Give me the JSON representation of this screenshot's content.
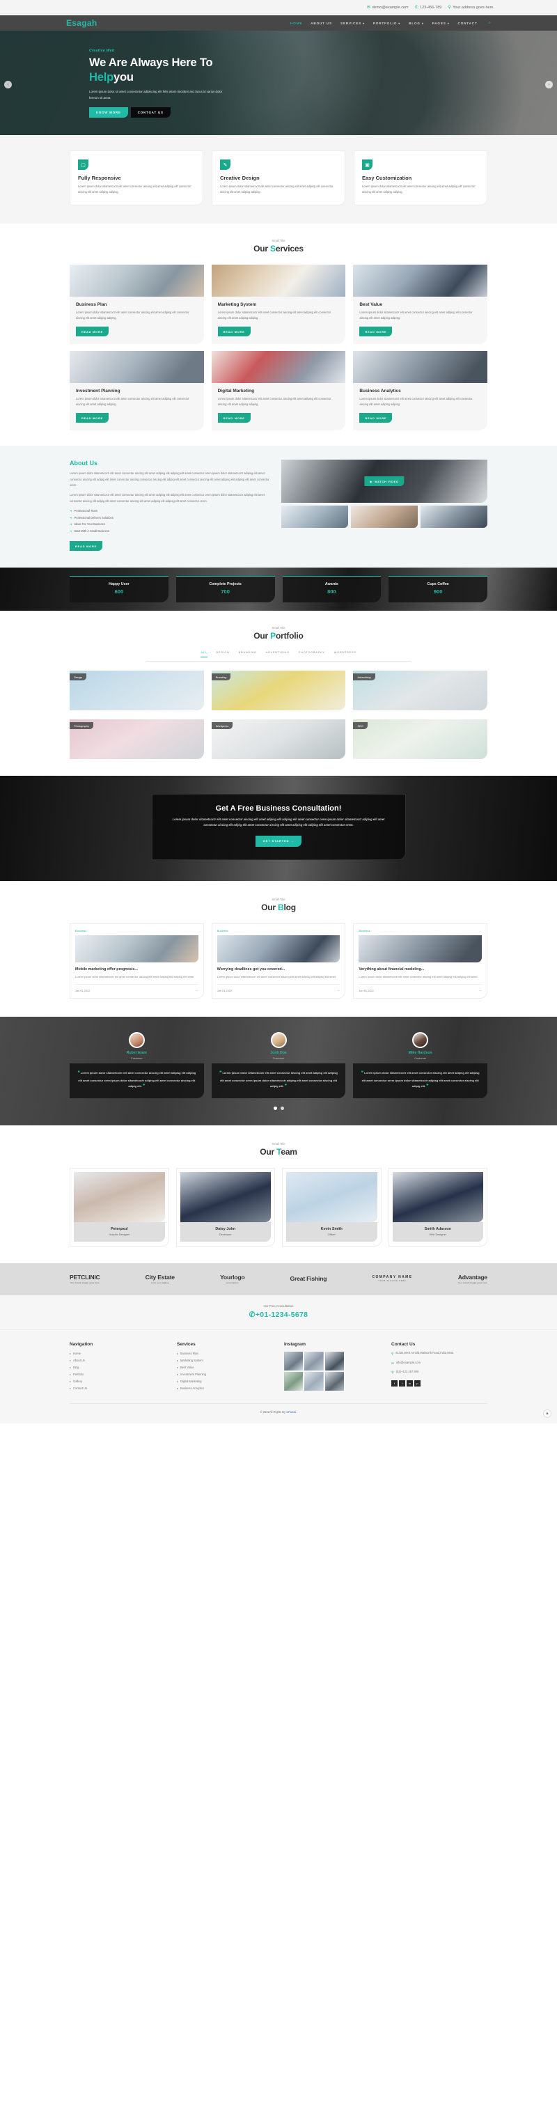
{
  "topbar": {
    "email": "demo@example.com",
    "phone": "123-456-789",
    "address": "Your address goes here."
  },
  "nav": {
    "brand": "Esagah",
    "items": [
      {
        "label": "HOME",
        "caret": ""
      },
      {
        "label": "ABOUT US",
        "caret": ""
      },
      {
        "label": "SERVICES",
        "caret": "▾"
      },
      {
        "label": "PORTFOLIO",
        "caret": "▾"
      },
      {
        "label": "BLOG",
        "caret": "▾"
      },
      {
        "label": "PAGES",
        "caret": "▾"
      },
      {
        "label": "CONTACT",
        "caret": ""
      }
    ]
  },
  "hero": {
    "small": "Creative Web",
    "title_line1": "We Are Always Here To",
    "title_accent": "Help",
    "title_rest": "you",
    "text": "Lorem ipsum dolor sit amet consectetur adipiscing elit felis etiam tincidunt arci lacus id varius dolor fermun sit amet.",
    "btn_primary": "KNOW MORE",
    "btn_secondary": "CONTGAT US",
    "arrow_left": "‹",
    "arrow_right": "›"
  },
  "features": [
    {
      "icon": "monitor-icon",
      "glyph": "▢",
      "title": "Fully Responsive",
      "text": "Lorem ipsum dolor sitametcoctr elit amet consectur aiscing elit amet adipisg elit consectur aiscing elit amet adipisg adipisg."
    },
    {
      "icon": "pencil-icon",
      "glyph": "✎",
      "title": "Creative Design",
      "text": "Lorem ipsum dolor sitametcoctr elit amet consectur aiscing elit amet adipisg elit consectur aiscing elit amet adipisg adipisg."
    },
    {
      "icon": "layout-icon",
      "glyph": "▣",
      "title": "Easy Customization",
      "text": "Lorem ipsum dolor sitametcoctr elit amet consectur aiscing elit amet adipisg elit consectur aiscing elit amet adipisg adipisg."
    }
  ],
  "services": {
    "small_title": "Small Title",
    "title_first": "Our ",
    "title_accent": "S",
    "title_rest": "ervices",
    "read_more": "READ MORE",
    "items": [
      {
        "title": "Business Plan",
        "text": "Lorem ipsum dolor sitametcoctr elit amet consectur aiscing elit amet adipisg elit consectur aiscing elit amet adipisg adipisg."
      },
      {
        "title": "Marketing System",
        "text": "Lorem ipsum dolor sitametcoctr elit amet consectur aiscing elit amet adipisg elit consectur aiscing elit amet adipisg adipisg."
      },
      {
        "title": "Best Value",
        "text": "Lorem ipsum dolor sitametcoctr elit amet consectur aiscing elit amet adipisg elit consectur aiscing elit amet adipisg adipisg."
      },
      {
        "title": "Investment Planning",
        "text": "Lorem ipsum dolor sitametcoctr elit amet consectur aiscing elit amet adipisg elit consectur aiscing elit amet adipisg adipisg."
      },
      {
        "title": "Digital Marketing",
        "text": "Lorem ipsum dolor sitametcoctr elit amet consectur aiscing elit amet adipisg elit consectur aiscing elit amet adipisg adipisg."
      },
      {
        "title": "Business Analytics",
        "text": "Lorem ipsum dolor sitametcoctr elit amet consectur aiscing elit amet adipisg elit consectur aiscing elit amet adipisg adipisg."
      }
    ]
  },
  "about": {
    "title": "About Us",
    "p1": "Lorem ipsum dolor sitametcoctr elit amet consectur aiscing elit amet adipisg elit adipisg elit amet consectur orem ipsum dolor sitametcoctr adipisg elit amet consectur aiscing elit adipig elit amet consectur aiscing consectur aiscing elit adipig elit amet consectur aiscing elit amet adipisg elit adipisg elit amet consectur orem.",
    "p2": "Lorem ipsum dolor sitametcoctr elit amet consectur aiscing elit amet adipisg elit adipisg elit amet consectur orem ipsum dolor sitametcoctr adipisg elit amet consectur aiscing elit adipig elit amet consectur aiscing elit amet adipisg elit adipisg elit amet consectur orem.",
    "bullets": [
      "Professional Team",
      "Professional Delivers Solutions",
      "Ideas For Your Business",
      "Start With A Small Business"
    ],
    "read_more": "READ MORE",
    "video_btn": "WATCH VIDEO"
  },
  "counters": [
    {
      "label": "Happy User",
      "value": "600"
    },
    {
      "label": "Complete Projects",
      "value": "700"
    },
    {
      "label": "Awards",
      "value": "800"
    },
    {
      "label": "Cups Coffee",
      "value": "900"
    }
  ],
  "portfolio": {
    "small_title": "Small Title",
    "title_first": "Our ",
    "title_accent": "P",
    "title_rest": "ortfolio",
    "filters": [
      "ALL",
      "DESIGN",
      "BRANDING",
      "ADVERTISING",
      "PHOTOGRAPHY",
      "WORDPRESS"
    ],
    "items": [
      "Design",
      "Branding",
      "Advertising",
      "Photography",
      "Wordpress",
      "SEO"
    ]
  },
  "cta": {
    "title": "Get A Free Business Consultation!",
    "text": "Lorem ipsum dolor sitametcoctr elit amet consectur aiscing elit amet adipisg elit adipisg elit amet consectur orem ipsum dolor sitametcoctr adipisg elit amet consectur aiscing elit adipig elit amet consectur aiscing elit amet adipisg elit adipisg elit amet consectur orem.",
    "button": "GET STARTED →"
  },
  "blog": {
    "small_title": "Small Title",
    "title_first": "Our ",
    "title_accent": "B",
    "title_rest": "log",
    "items": [
      {
        "cat": "Business",
        "title": "Mobile marketing offer prognosis...",
        "text": "Lorem ipsum dolor sitametcoctr elit amet consectur aiscing elit amet adipisg elit adipisg elit amet.",
        "date": "Jan 01,2022",
        "arrow": "→"
      },
      {
        "cat": "Business",
        "title": "Worrying deadlines got you covered...",
        "text": "Lorem ipsum dolor sitametcoctr elit amet consectur aiscing elit amet adipisg elit adipisg elit amet.",
        "date": "Jan 01,2022",
        "arrow": "→"
      },
      {
        "cat": "Business",
        "title": "Verything about financial modeling...",
        "text": "Lorem ipsum dolor sitametcoctr elit amet consectur aiscing elit amet adipisg elit adipisg elit amet.",
        "date": "Jan 01,2022",
        "arrow": "→"
      }
    ]
  },
  "testimonials": {
    "items": [
      {
        "name": "Rubel Islam",
        "role": "Customer",
        "quote": "Lorem ipsum dolor sitametcoctr elit amet consectur aiscing elit amet adipisg elit adipisg elit amet consectur orem ipsum dolor sitametcoctr adipisg elit amet consectur aiscing elit adipig elit."
      },
      {
        "name": "Jonh Doe",
        "role": "Customer",
        "quote": "Lorem ipsum dolor sitametcoctr elit amet consectur aiscing elit amet adipisg elit adipisg elit amet consectur orem ipsum dolor sitametcoctr adipisg elit amet consectur aiscing elit adipig elit."
      },
      {
        "name": "Mike Hardson",
        "role": "Customer",
        "quote": "Lorem ipsum dolor sitametcoctr elit amet consectur aiscing elit amet adipisg elit adipisg elit amet consectur orem ipsum dolor sitametcoctr adipisg elit amet consectur aiscing elit adipig elit."
      }
    ],
    "quote_open": "❝",
    "quote_close": "❞"
  },
  "team": {
    "small_title": "Small Title",
    "title_first": "Our ",
    "title_accent": "T",
    "title_rest": "eam",
    "members": [
      {
        "name": "Peterpaul",
        "role": "Graphic Designer"
      },
      {
        "name": "Daisy John",
        "role": "Developer"
      },
      {
        "name": "Kevin Smith",
        "role": "Officer"
      },
      {
        "name": "Smith Adarson",
        "role": "Web Designer"
      }
    ]
  },
  "clients": [
    {
      "main": "PETCLINIC",
      "sub": "Your brand slogan goes here"
    },
    {
      "main": "City Estate",
      "sub": "to for your tagline"
    },
    {
      "main": "Yourlogo",
      "sub": "LoremIpsum"
    },
    {
      "main": "Great Fishing",
      "sub": ""
    },
    {
      "main": "COMPANY NAME",
      "sub": "YOUR TAGLINE HERE"
    },
    {
      "main": "Advantage",
      "sub": "Your brand slogan goes here"
    }
  ],
  "consult": {
    "label": "Hor Free Consultation",
    "phone": "+01-1234-5678",
    "phone_icon": "✆"
  },
  "footer": {
    "nav_heading": "Navigation",
    "nav_items": [
      "Home",
      "About Us",
      "Blog",
      "Portfolio",
      "Gallery",
      "Contact Us"
    ],
    "services_heading": "Services",
    "services_items": [
      "Business Plan",
      "Marketing System",
      "Best Value",
      "Investment Planning",
      "Digital Marketing",
      "Business Analytics"
    ],
    "instagram_heading": "Instagram",
    "contact_heading": "Contact Us",
    "contact_address": "91/1B,West Arnold,Walworth Road,India,9845",
    "contact_email": "info@example.com",
    "contact_phone": "(81)+123 457 890",
    "socials": [
      "f",
      "t",
      "in",
      "p"
    ],
    "copyright_prefix": "© 2022All Rights By ",
    "copyright_link": "17sucai",
    "copyright_suffix": ".",
    "to_top": "▲"
  }
}
